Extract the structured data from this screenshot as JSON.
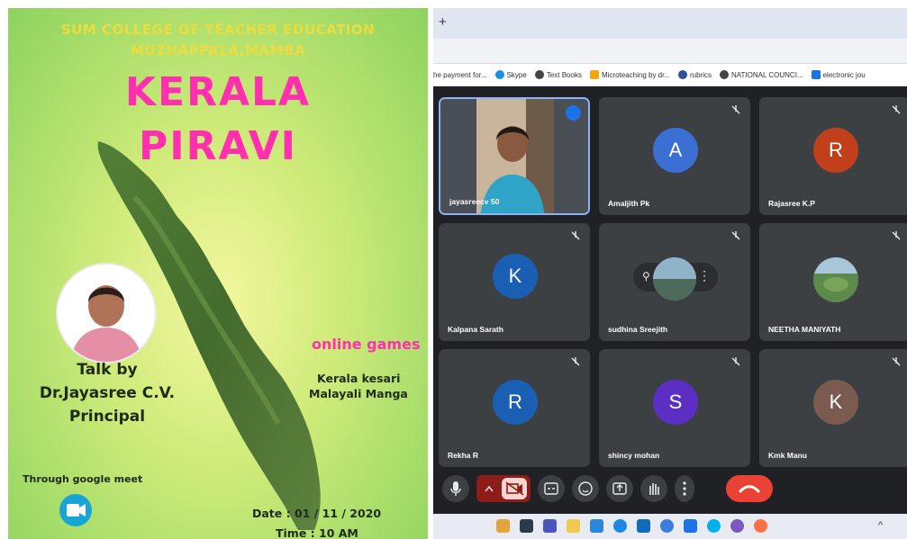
{
  "poster": {
    "college": "SUM COLLEGE OF TEACHER EDUCATION",
    "place": "MUZHAPPALA,MAMBA",
    "title_line1": "KERALA",
    "title_line2": "PIRAVI",
    "talk_line1": "Talk by",
    "talk_line2": "Dr.Jayasree C.V.",
    "talk_line3": "Principal",
    "games_heading": "online games",
    "game1": "Kerala kesari",
    "game2": "Malayali Manga",
    "platform": "Through google meet",
    "date": "Date : 01 / 11 / 2020",
    "time": "Time : 10 AM"
  },
  "browser": {
    "new_tab": "+",
    "bookmarks": [
      {
        "label": "he payment for...",
        "icon": "blank-page-icon"
      },
      {
        "label": "Skype",
        "icon": "skype-icon",
        "color": "#1a8fe3"
      },
      {
        "label": "Text Books",
        "icon": "globe-icon",
        "color": "#444444"
      },
      {
        "label": "Microteaching by dr...",
        "icon": "microteaching-icon",
        "color": "#f2a50c"
      },
      {
        "label": "rubrics",
        "icon": "rubrics-icon",
        "color": "#2c4f9e"
      },
      {
        "label": "NATIONAL COUNCI...",
        "icon": "globe-icon",
        "color": "#444444"
      },
      {
        "label": "electronic jou",
        "icon": "doc-icon",
        "color": "#1a73e8"
      }
    ]
  },
  "meet": {
    "participants": [
      {
        "name": "jayasreecv 50",
        "initial": "",
        "color": "",
        "video": true
      },
      {
        "name": "Amaljith Pk",
        "initial": "A",
        "color": "#3c6fd4"
      },
      {
        "name": "Rajasree K.P",
        "initial": "R",
        "color": "#c1401b"
      },
      {
        "name": "Kalpana Sarath",
        "initial": "K",
        "color": "#1a5fb4"
      },
      {
        "name": "sudhina Sreejith",
        "initial": "",
        "color": "",
        "photo": true
      },
      {
        "name": "NEETHA MANIYATH",
        "initial": "",
        "color": "",
        "photo": true
      },
      {
        "name": "Rekha R",
        "initial": "R",
        "color": "#1a5fb4"
      },
      {
        "name": "shincy mohan",
        "initial": "S",
        "color": "#5b2fc4"
      },
      {
        "name": "Kmk Manu",
        "initial": "K",
        "color": "#7b5a50"
      }
    ],
    "controls": [
      "mic-icon",
      "chevron-up-icon",
      "camera-off-icon",
      "captions-icon",
      "emoji-icon",
      "present-icon",
      "raise-hand-icon",
      "more-icon",
      "end-call-icon"
    ]
  },
  "colors": {
    "meet_bg": "#202124",
    "tile_bg": "#3c4043",
    "end_call": "#ea4335",
    "title_pink": "#ff2fb0"
  }
}
